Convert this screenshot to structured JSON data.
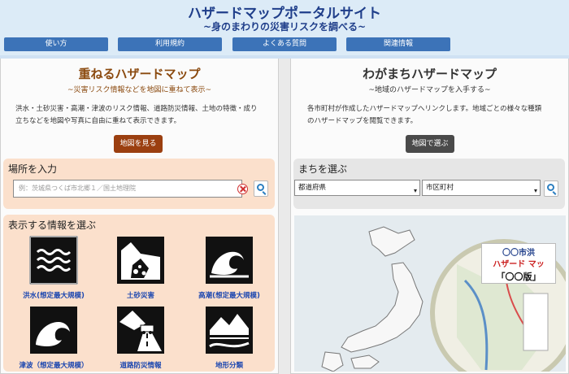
{
  "header": {
    "title": "ハザードマップポータルサイト",
    "subtitle": "~身のまわりの災害リスクを調べる~",
    "nav": [
      "使い方",
      "利用規約",
      "よくある質問",
      "関連情報"
    ]
  },
  "left_panel": {
    "title": "重ねるハザードマップ",
    "subtitle": "~災害リスク情報などを地図に重ねて表示~",
    "desc_line1": "洪水・土砂災害・高潮・津波のリスク情報、道路防災情報、土地の特徴・成り",
    "desc_line2": "立ちなどを地図や写真に自由に重ねて表示できます。",
    "button": "地図を見る",
    "search": {
      "title": "場所を入力",
      "placeholder": "例：茨城県つくば市北郷１／国土地理院"
    },
    "info": {
      "title": "表示する情報を選ぶ",
      "items": [
        "洪水(想定最大規模)",
        "土砂災害",
        "高潮(想定最大規模)",
        "津波（想定最大規模）",
        "道路防災情報",
        "地形分類"
      ]
    }
  },
  "right_panel": {
    "title": "わがまちハザードマップ",
    "subtitle": "~地域のハザードマップを入手する~",
    "desc_line1": "各市町村が作成したハザードマップへリンクします。地域ごとの様々な種類",
    "desc_line2": "のハザードマップを閲覧できます。",
    "button": "地図で選ぶ",
    "town": {
      "title": "まちを選ぶ",
      "prefecture": "都道府県",
      "city": "市区町村"
    },
    "callout": {
      "line1": "〇〇市洪",
      "line2": "ハザード マッ",
      "line3": "「〇〇版」"
    }
  },
  "colors": {
    "header_bg": "#dcebf7",
    "title": "#1f3e8a",
    "nav": "#3c73b8",
    "left_title": "#8b4a0f",
    "left_button": "#9b3f10",
    "right_button": "#4a4a4a",
    "search_box": "#fbe0cc",
    "link": "#1b46b0"
  }
}
